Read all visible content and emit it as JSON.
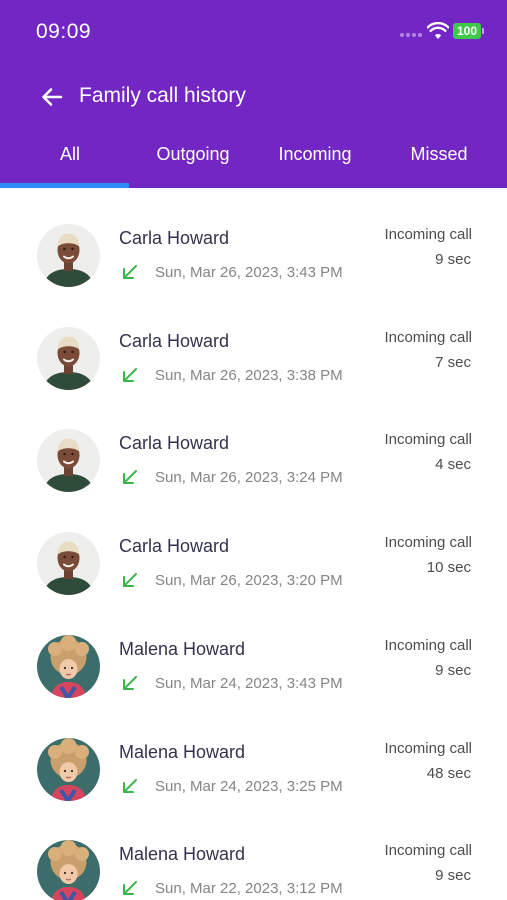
{
  "status_bar": {
    "time": "09:09",
    "battery": "100"
  },
  "header": {
    "title": "Family call history",
    "back_icon": "arrow-left-icon"
  },
  "tabs": [
    {
      "label": "All",
      "selected": true
    },
    {
      "label": "Outgoing",
      "selected": false
    },
    {
      "label": "Incoming",
      "selected": false
    },
    {
      "label": "Missed",
      "selected": false
    }
  ],
  "colors": {
    "header": "#7226c4",
    "tab_indicator": "#2f8cf5",
    "incoming_arrow": "#3bb54a"
  },
  "calls": [
    {
      "name": "Carla Howard",
      "avatar": "carla",
      "direction_icon": "incoming-arrow-icon",
      "date": "Sun, Mar 26, 2023, 3:43 PM",
      "type": "Incoming call",
      "duration": "9 sec"
    },
    {
      "name": "Carla Howard",
      "avatar": "carla",
      "direction_icon": "incoming-arrow-icon",
      "date": "Sun, Mar 26, 2023, 3:38 PM",
      "type": "Incoming call",
      "duration": "7 sec"
    },
    {
      "name": "Carla Howard",
      "avatar": "carla",
      "direction_icon": "incoming-arrow-icon",
      "date": "Sun, Mar 26, 2023, 3:24 PM",
      "type": "Incoming call",
      "duration": "4 sec"
    },
    {
      "name": "Carla Howard",
      "avatar": "carla",
      "direction_icon": "incoming-arrow-icon",
      "date": "Sun, Mar 26, 2023, 3:20 PM",
      "type": "Incoming call",
      "duration": "10 sec"
    },
    {
      "name": "Malena Howard",
      "avatar": "malena",
      "direction_icon": "incoming-arrow-icon",
      "date": "Sun, Mar 24, 2023, 3:43 PM",
      "type": "Incoming call",
      "duration": "9 sec"
    },
    {
      "name": "Malena Howard",
      "avatar": "malena",
      "direction_icon": "incoming-arrow-icon",
      "date": "Sun, Mar 24, 2023, 3:25 PM",
      "type": "Incoming call",
      "duration": "48 sec"
    },
    {
      "name": "Malena Howard",
      "avatar": "malena",
      "direction_icon": "incoming-arrow-icon",
      "date": "Sun, Mar 22, 2023, 3:12 PM",
      "type": "Incoming call",
      "duration": "9 sec"
    }
  ]
}
